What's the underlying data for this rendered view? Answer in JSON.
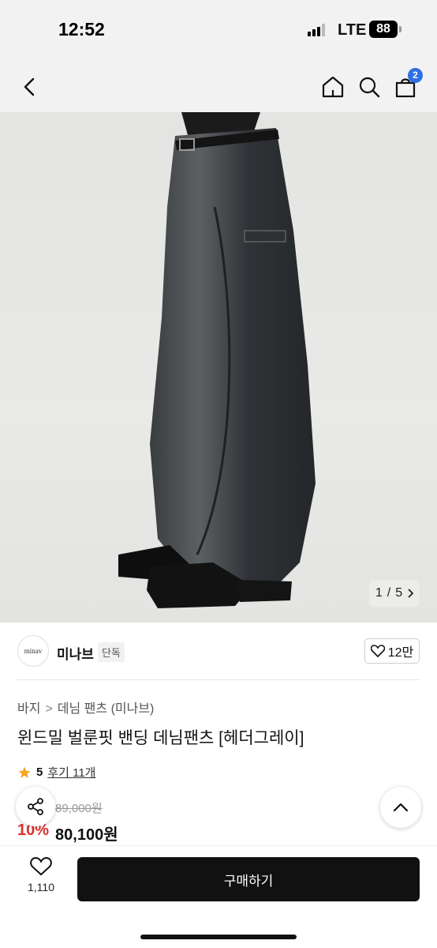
{
  "status": {
    "time": "12:52",
    "network": "LTE",
    "battery": "88"
  },
  "nav": {
    "cart_count": "2"
  },
  "gallery": {
    "current": "1",
    "total": "5",
    "sep": "/"
  },
  "brand": {
    "logo_text": "minav",
    "name": "미나브",
    "tag": "단독",
    "likes": "12만"
  },
  "breadcrumb": {
    "level1": "바지",
    "level2": "데님 팬츠 (미나브)",
    "separator": ">"
  },
  "product": {
    "title": "윈드밀 벌룬핏 밴딩 데님팬츠 [헤더그레이]",
    "rating": "5",
    "reviews": "후기 11개",
    "original_price": "89,000원",
    "discount": "10%",
    "sale_price": "80,100원"
  },
  "bottom": {
    "wish_count": "1,110",
    "buy_label": "구매하기"
  },
  "colors": {
    "accent_badge": "#2f6fe4",
    "discount": "#e0302d",
    "buy_button": "#111111",
    "star": "#f5a623"
  }
}
